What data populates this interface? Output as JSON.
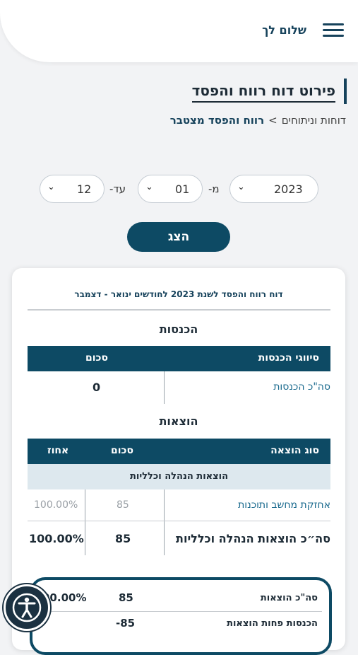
{
  "header": {
    "greeting": "שלום לך",
    "menu_icon": "hamburger-icon"
  },
  "page": {
    "title": "פירוט דוח רווח והפסד",
    "breadcrumb": {
      "parent": "דוחות וניתוחים",
      "separator": ">",
      "current": "רווח והפסד מצטבר"
    }
  },
  "filters": {
    "year": "2023",
    "from_label": "מ-",
    "from_month": "01",
    "to_label": "עד-",
    "to_month": "12",
    "submit_label": "הצג"
  },
  "report": {
    "heading": "דוח רווח והפסד לשנת 2023 לחודשים ינואר - דצמבר",
    "income": {
      "title": "הכנסות",
      "col_type": "סיווגי הכנסות",
      "col_amount": "סכום",
      "total_label": "סה\"כ הכנסות",
      "total_value": "0"
    },
    "expenses": {
      "title": "הוצאות",
      "col_type": "סוג הוצאה",
      "col_amount": "סכום",
      "col_percent": "אחוז",
      "category": "הוצאות הנהלה וכלליות",
      "rows": [
        {
          "label": "אחזקת מחשב ותוכנות",
          "amount": "85",
          "percent": "100.00%"
        }
      ],
      "category_total": {
        "label": "סה״כ הוצאות הנהלה וכלליות",
        "amount": "85",
        "percent": "100.00%"
      }
    },
    "summary": {
      "total_expenses_label": "סה\"כ הוצאות",
      "total_expenses_amount": "85",
      "total_expenses_percent": "00.00%",
      "net_label": "הכנסות פחות הוצאות",
      "net_amount": "-85"
    }
  },
  "accessibility": {
    "icon": "accessibility-icon"
  },
  "colors": {
    "primary": "#0d4a64",
    "link": "#1a6a8e",
    "subheader_bg": "#dde8ee"
  }
}
